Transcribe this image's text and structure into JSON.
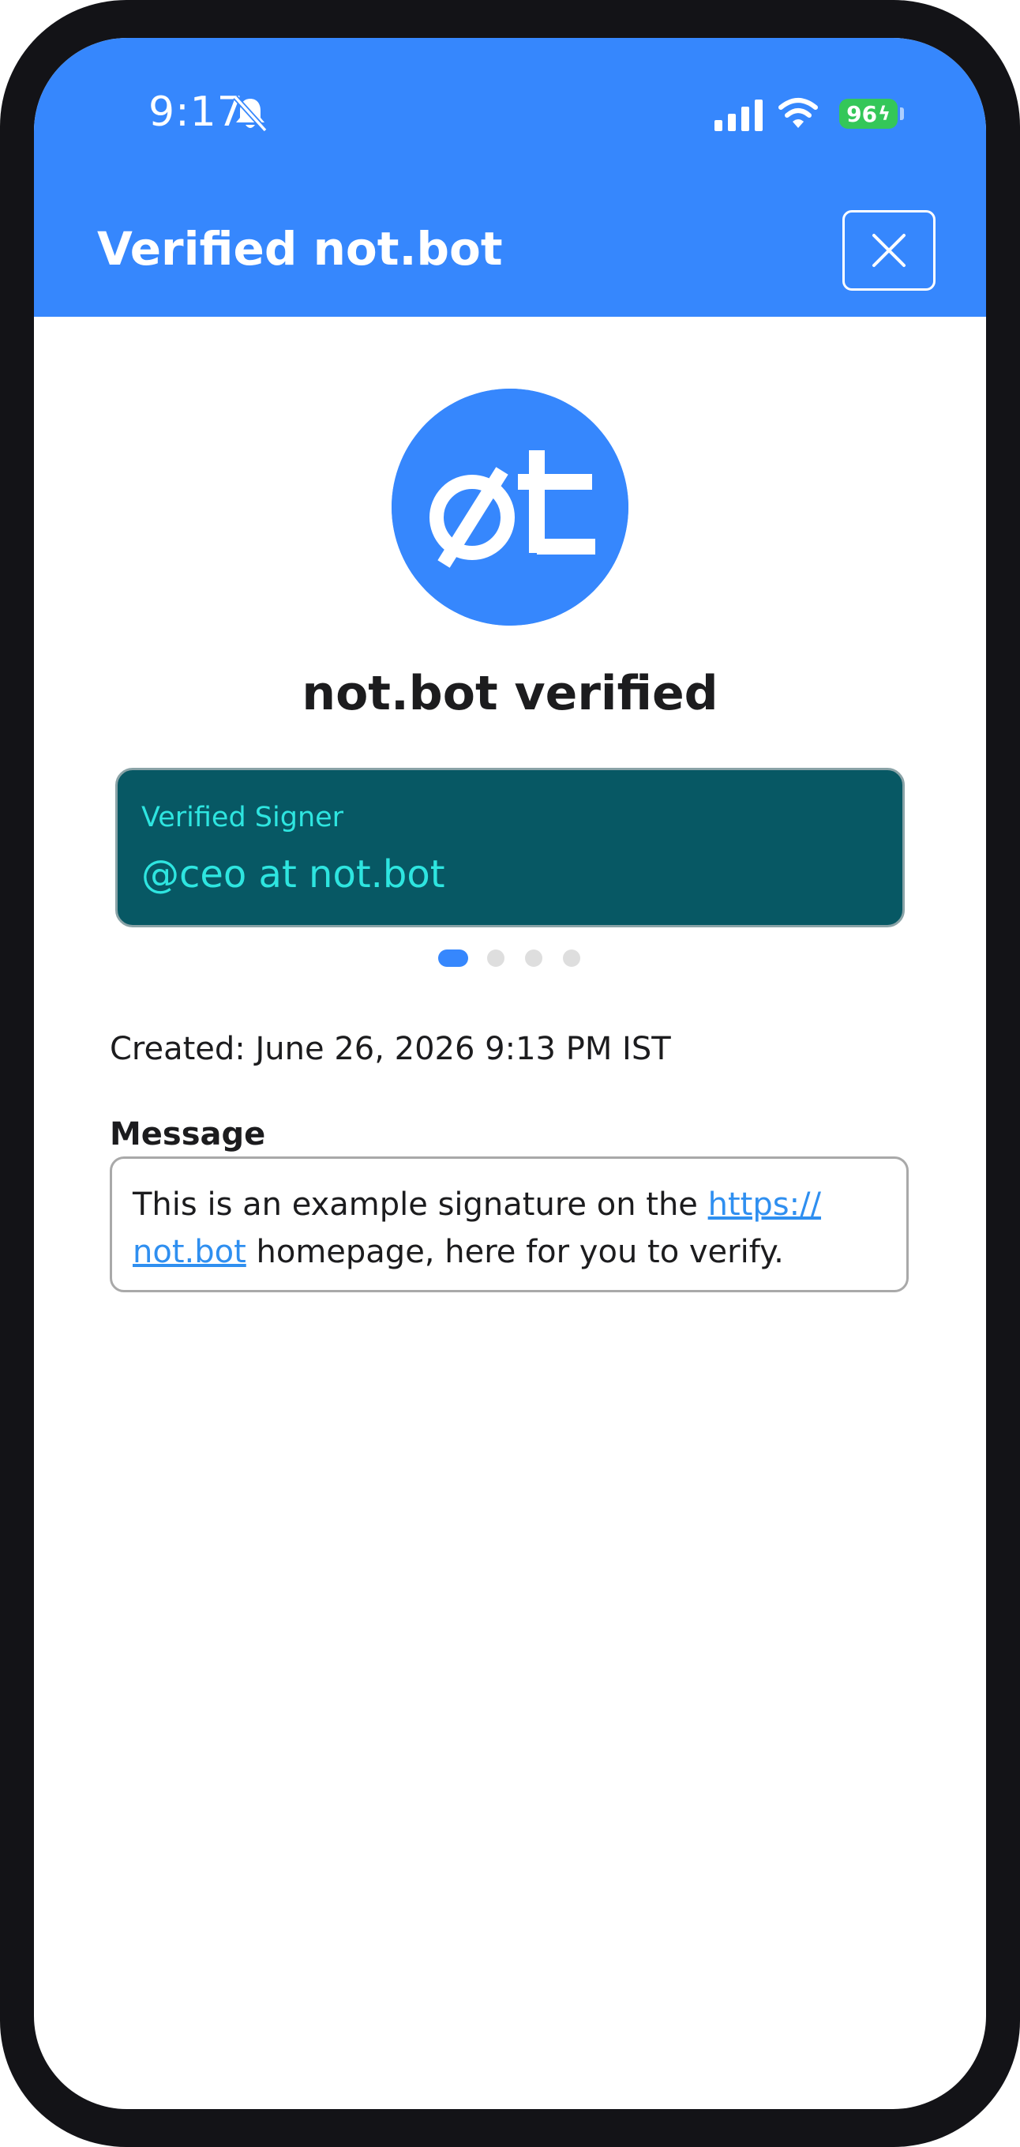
{
  "status_bar": {
    "time": "9:17",
    "battery": "96",
    "icons": [
      "bell-slash-icon",
      "signal-icon",
      "wifi-icon",
      "battery-charging-icon"
    ]
  },
  "header": {
    "title": "Verified not.bot",
    "close_icon": "close-icon"
  },
  "logo": {
    "text": "øt"
  },
  "verification": {
    "title": "not.bot verified"
  },
  "signer_card": {
    "label": "Verified Signer",
    "value": "@ceo at not.bot"
  },
  "pager": {
    "count": 4,
    "active": 1
  },
  "created": "Created: June 26, 2026 9:13 PM IST",
  "message": {
    "label": "Message",
    "text_before": "This is an example signature on the ",
    "link_text": "https://\nnot.bot",
    "text_after": " homepage, here for you to verify."
  },
  "colors": {
    "accent": "#3687fd",
    "card_bg": "#075864",
    "card_text": "#2ee5e0",
    "link": "#2f8ff0"
  }
}
